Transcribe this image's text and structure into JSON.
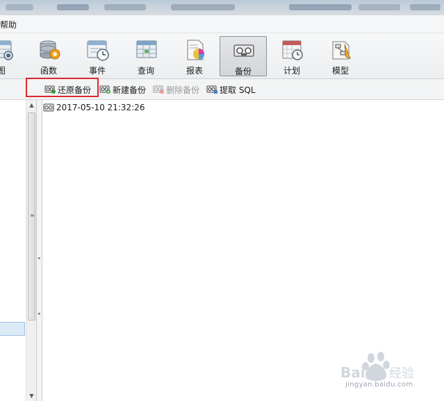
{
  "menubar": {
    "help_label": "帮助"
  },
  "toolbar": {
    "items": [
      {
        "label": "图",
        "icon": "view-icon"
      },
      {
        "label": "函数",
        "icon": "function-icon"
      },
      {
        "label": "事件",
        "icon": "event-icon"
      },
      {
        "label": "查询",
        "icon": "query-icon"
      },
      {
        "label": "报表",
        "icon": "report-icon"
      },
      {
        "label": "备份",
        "icon": "backup-icon",
        "active": true
      },
      {
        "label": "计划",
        "icon": "schedule-icon"
      },
      {
        "label": "模型",
        "icon": "model-icon"
      }
    ]
  },
  "backup_toolbar": {
    "restore_label": "还原备份",
    "new_label": "新建备份",
    "delete_label": "删除备份",
    "extract_label": "提取 SQL"
  },
  "backup_list": {
    "items": [
      {
        "label": "2017-05-10 21:32:26"
      }
    ]
  },
  "watermark": {
    "brand": "Bai百度 经验",
    "url": "jingyan.baidu.com"
  },
  "colors": {
    "highlight": "#e0262b",
    "selection": "#dce9f7",
    "accent": "#f0a020"
  }
}
